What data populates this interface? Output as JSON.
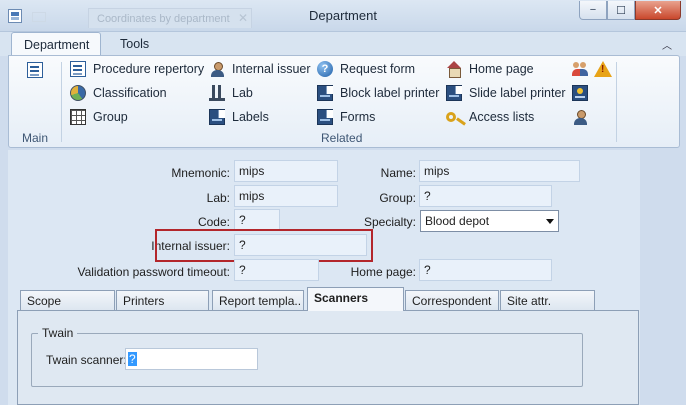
{
  "window": {
    "title": "Department",
    "ghost_tab": "Coordinates by department",
    "close_glyph": "✕",
    "min_glyph": "−",
    "max_glyph": "☐"
  },
  "ribbon": {
    "tabs": [
      "Department",
      "Tools"
    ],
    "collapse_glyph": "︿",
    "groups": {
      "main": "Main",
      "related": "Related"
    },
    "items": {
      "procedure": "Procedure repertory",
      "classification": "Classification",
      "group": "Group",
      "internal_issuer": "Internal issuer",
      "lab": "Lab",
      "labels": "Labels",
      "request_form": "Request form",
      "block_label_printer": "Block label printer",
      "forms": "Forms",
      "home_page": "Home page",
      "slide_label_printer": "Slide label printer",
      "access_lists": "Access lists"
    },
    "icons": {
      "main": "document-list-icon",
      "help": "help-icon",
      "key": "key-icon",
      "warning": "warning-icon"
    }
  },
  "form": {
    "mnemonic_label": "Mnemonic:",
    "mnemonic": "mips",
    "name_label": "Name:",
    "name": "mips",
    "lab_label": "Lab:",
    "lab": "mips",
    "group_label": "Group:",
    "group": "?",
    "code_label": "Code:",
    "code": "?",
    "specialty_label": "Specialty:",
    "specialty": "Blood depot",
    "internal_issuer_label": "Internal issuer:",
    "internal_issuer": "?",
    "validation_label": "Validation password timeout:",
    "validation": "?",
    "home_page_label": "Home page:",
    "home_page": "?"
  },
  "tabs": [
    "Scope",
    "Printers",
    "Report templa..",
    "Scanners",
    "Correspondent",
    "Site attr."
  ],
  "active_tab": "Scanners",
  "twain": {
    "title": "Twain",
    "scanner_label": "Twain scanner:",
    "scanner_value": "?"
  },
  "colors": {
    "highlight": "#b3262b",
    "selection": "#3399ff"
  }
}
